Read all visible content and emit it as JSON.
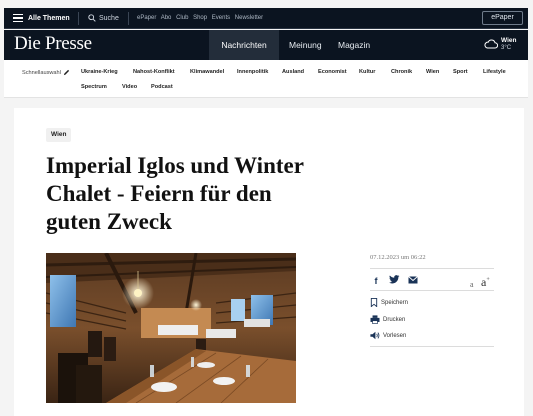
{
  "topbar": {
    "menu_label": "Alle Themen",
    "search_label": "Suche",
    "links": [
      "ePaper",
      "Abo",
      "Club",
      "Shop",
      "Events",
      "Newsletter"
    ],
    "epaper_button": "ePaper"
  },
  "header": {
    "logo": "Die Presse",
    "nav": [
      "Nachrichten",
      "Meinung",
      "Magazin"
    ],
    "active_nav": "Nachrichten",
    "weather_city": "Wien",
    "weather_temp": "3°C"
  },
  "categories": {
    "quick_select_label": "Schnellauswahl",
    "row1": [
      "Ukraine-Krieg",
      "Nahost-Konflikt",
      "Klimawandel",
      "Innenpolitik",
      "Ausland",
      "Economist",
      "Kultur",
      "Chronik",
      "Wien",
      "Sport",
      "Lifestyle"
    ],
    "row2": [
      "Spectrum",
      "Video",
      "Podcast"
    ]
  },
  "article": {
    "tag": "Wien",
    "headline": "Imperial Iglos und Winter Chalet - Feiern für den guten Zweck",
    "date": "07.12.2023 um 06:22",
    "font_small": "a",
    "font_large": "a",
    "actions": {
      "save": "Speichern",
      "print": "Drucken",
      "read_aloud": "Vorlesen"
    }
  },
  "colors": {
    "header_bg": "#0b1420",
    "active_nav_bg": "#232d3a",
    "share_icon": "#1a3357"
  }
}
